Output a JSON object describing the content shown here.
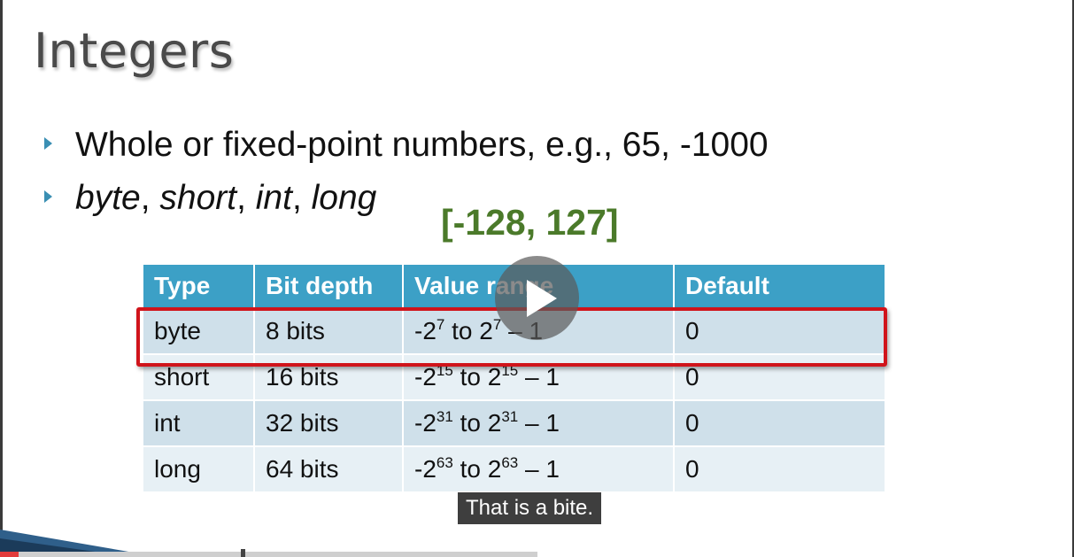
{
  "slide": {
    "title": "Integers",
    "bullets": [
      "Whole or fixed-point numbers, e.g., 65, -1000"
    ],
    "types_bullet": {
      "items": [
        "byte",
        "short",
        "int",
        "long"
      ],
      "separator": ", "
    },
    "range_note": "[-128, 127]",
    "table": {
      "headers": [
        "Type",
        "Bit depth",
        "Value range",
        "Default"
      ],
      "rows": [
        {
          "type": "byte",
          "bits": "8 bits",
          "neg": "-2",
          "exp": "7",
          "to": " to 2",
          "exp2": "7",
          "tail": " – 1",
          "default": "0"
        },
        {
          "type": "short",
          "bits": "16 bits",
          "neg": "-2",
          "exp": "15",
          "to": " to 2",
          "exp2": "15",
          "tail": " – 1",
          "default": "0"
        },
        {
          "type": "int",
          "bits": "32 bits",
          "neg": "-2",
          "exp": "31",
          "to": " to 2",
          "exp2": "31",
          "tail": " – 1",
          "default": "0"
        },
        {
          "type": "long",
          "bits": "64 bits",
          "neg": "-2",
          "exp": "63",
          "to": " to 2",
          "exp2": "63",
          "tail": " – 1",
          "default": "0"
        }
      ]
    }
  },
  "player": {
    "caption": "That is a bite.",
    "play_icon": "play-icon",
    "progress_fraction": 0.035
  },
  "colors": {
    "header_bg": "#3ca0c6",
    "highlight": "#d0141b",
    "range_note": "#4b7a2a",
    "bullet_arrow": "#3a8fb3"
  }
}
